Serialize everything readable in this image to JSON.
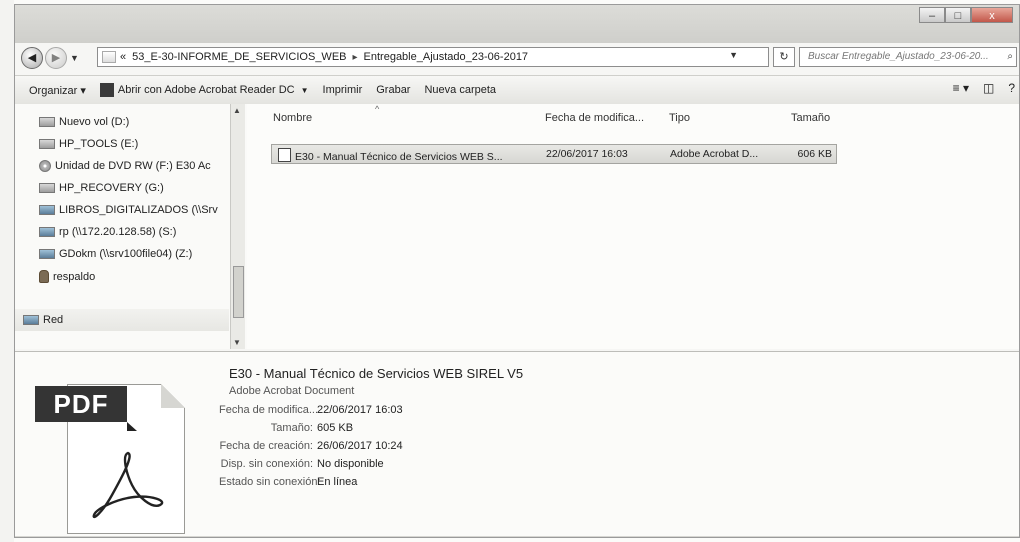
{
  "window": {
    "buttons": [
      "–",
      "□",
      "x"
    ]
  },
  "address_bar": {
    "prefix": "«",
    "path": [
      "53_E-30-INFORME_DE_SERVICIOS_WEB",
      "Entregable_Ajustado_23-06-2017"
    ],
    "separator": "▸",
    "refresh_glyph": "↻",
    "search_placeholder": "Buscar Entregable_Ajustado_23-06-20...",
    "search_icon_glyph": "⌕"
  },
  "toolbar": {
    "organize": "Organizar ▾",
    "open_with": "Abrir con Adobe Acrobat Reader DC",
    "print": "Imprimir",
    "burn": "Grabar",
    "new_folder": "Nueva carpeta",
    "views_glyph": "≡ ▾",
    "preview_glyph": "◫",
    "help_glyph": "?"
  },
  "nav_pane": {
    "items": [
      "Nuevo vol (D:)",
      "HP_TOOLS (E:)",
      "Unidad de DVD RW (F:) E30 Ac",
      "HP_RECOVERY (G:)",
      "LIBROS_DIGITALIZADOS (\\\\Srv",
      "rp (\\\\172.20.128.58) (S:)",
      "GDokm (\\\\srv100file04) (Z:)",
      "respaldo"
    ],
    "network": "Red"
  },
  "file_list": {
    "columns": [
      "Nombre",
      "Fecha de modifica...",
      "Tipo",
      "Tamaño"
    ],
    "rows": [
      {
        "name": "E30 - Manual Técnico de Servicios WEB S...",
        "modified": "22/06/2017 16:03",
        "type": "Adobe Acrobat D...",
        "size": "606 KB"
      }
    ]
  },
  "details": {
    "badge": "PDF",
    "name": "E30 - Manual Técnico de Servicios WEB SIREL V5",
    "type": "Adobe Acrobat Document",
    "props": [
      {
        "label": "Fecha de modifica...",
        "value": "22/06/2017 16:03"
      },
      {
        "label": "Tamaño:",
        "value": "605 KB"
      },
      {
        "label": "Fecha de creación:",
        "value": "26/06/2017 10:24"
      },
      {
        "label": "Disp. sin conexión:",
        "value": "No disponible"
      },
      {
        "label": "Estado sin conexión:",
        "value": "En línea"
      }
    ]
  },
  "colors": {
    "selection": "#dcdcd8",
    "badge": "#343434"
  }
}
